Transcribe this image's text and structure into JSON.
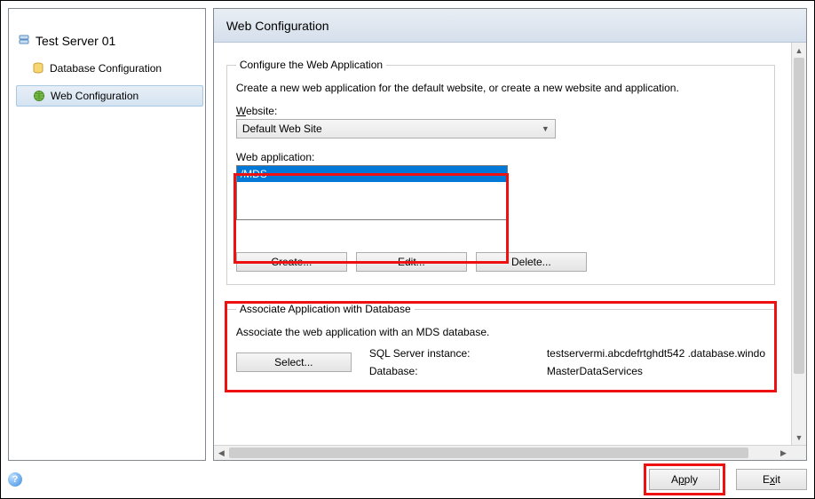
{
  "sidebar": {
    "root_label": "Test Server 01",
    "items": [
      {
        "label": "Database Configuration"
      },
      {
        "label": "Web Configuration"
      }
    ]
  },
  "main": {
    "title": "Web Configuration",
    "configure": {
      "legend": "Configure the Web Application",
      "description": "Create a new web application for the default website, or create a new website and application.",
      "website_label_pre": "W",
      "website_label_post": "ebsite:",
      "website_value": "Default Web Site",
      "webapp_label": "Web application:",
      "webapp_items": [
        "/MDS"
      ],
      "buttons": {
        "create": "Create...",
        "edit": "Edit...",
        "delete": "Delete..."
      }
    },
    "associate": {
      "legend": "Associate Application with Database",
      "description": "Associate the web application with an MDS database.",
      "select_label": "Select...",
      "sql_label": "SQL Server instance:",
      "sql_value": "testservermi.abcdefrtghdt542 .database.windo",
      "db_label": "Database:",
      "db_value": "MasterDataServices"
    }
  },
  "footer": {
    "apply_pre": "A",
    "apply_mid": "p",
    "apply_post": "ply",
    "exit_pre": "E",
    "exit_mid": "x",
    "exit_post": "it"
  }
}
